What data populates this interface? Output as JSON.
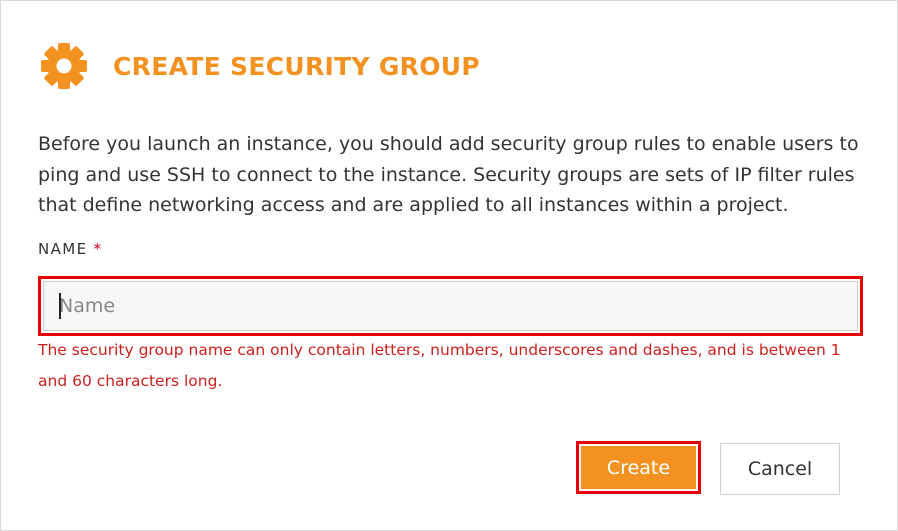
{
  "dialog": {
    "title": "CREATE SECURITY GROUP",
    "icon": "gear-icon",
    "description": "Before you launch an instance, you should add security group rules to enable users to ping and use SSH to connect to the instance. Security groups are sets of IP filter rules that define networking access and are applied to all instances within a project."
  },
  "form": {
    "name_label": "NAME",
    "required_marker": "*",
    "name_value": "",
    "name_placeholder": "Name",
    "name_error": "The security group name can only contain letters, numbers, underscores and dashes, and is between 1 and 60 characters long."
  },
  "actions": {
    "create_label": "Create",
    "cancel_label": "Cancel"
  },
  "colors": {
    "accent": "#f39221",
    "error": "#c9211e",
    "highlight_border": "#e60000"
  }
}
